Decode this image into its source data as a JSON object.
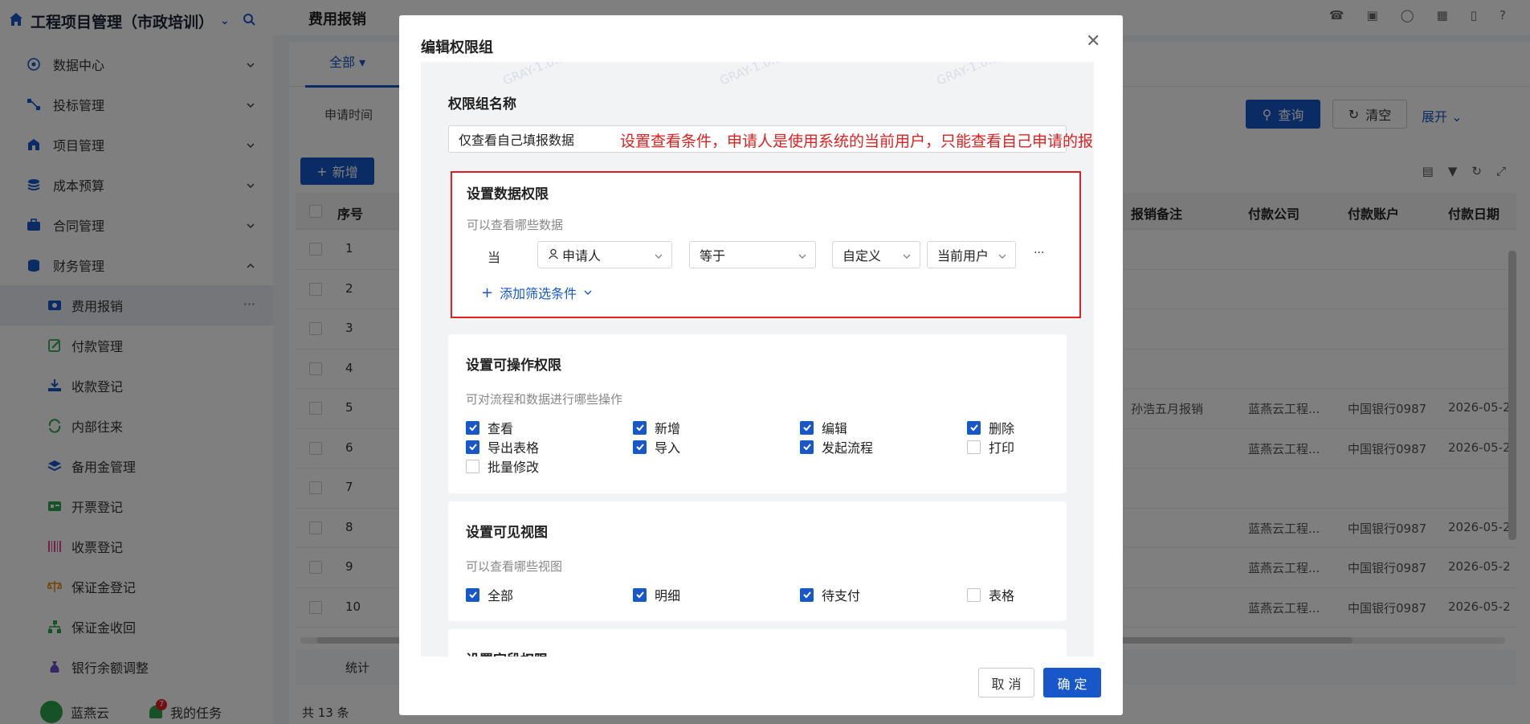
{
  "app": {
    "title": "工程项目管理（市政培训）"
  },
  "sidebar": {
    "items": [
      {
        "label": "数据中心",
        "icon": "dashboard-icon"
      },
      {
        "label": "投标管理",
        "icon": "bidding-icon"
      },
      {
        "label": "项目管理",
        "icon": "project-icon"
      },
      {
        "label": "成本预算",
        "icon": "budget-icon"
      },
      {
        "label": "合同管理",
        "icon": "contract-icon"
      },
      {
        "label": "财务管理",
        "icon": "finance-icon"
      }
    ],
    "sub_items": [
      {
        "label": "费用报销",
        "icon": "reimburse-icon"
      },
      {
        "label": "付款管理",
        "icon": "payment-icon"
      },
      {
        "label": "收款登记",
        "icon": "receipt-icon"
      },
      {
        "label": "内部往来",
        "icon": "transfer-icon"
      },
      {
        "label": "备用金管理",
        "icon": "petty-cash-icon"
      },
      {
        "label": "开票登记",
        "icon": "invoice-icon"
      },
      {
        "label": "收票登记",
        "icon": "barcode-icon"
      },
      {
        "label": "保证金登记",
        "icon": "scale-icon"
      },
      {
        "label": "保证金收回",
        "icon": "org-icon"
      },
      {
        "label": "银行余额调整",
        "icon": "bank-icon"
      }
    ],
    "bottom": {
      "org": "蓝燕云",
      "tasks": "我的任务",
      "task_badge": "7"
    }
  },
  "page": {
    "title": "费用报销",
    "tab_all": "全部",
    "filter_label": "申请时间",
    "search_label": "查询",
    "clear_label": "清空",
    "expand_label": "展开",
    "new_label": "新增",
    "columns": [
      "序号",
      "报销备注",
      "付款公司",
      "付款账户",
      "付款日期"
    ],
    "rows": [
      {
        "no": "1",
        "note": "",
        "company": "",
        "account": "",
        "date": ""
      },
      {
        "no": "2",
        "note": "",
        "company": "",
        "account": "",
        "date": ""
      },
      {
        "no": "3",
        "note": "",
        "company": "",
        "account": "",
        "date": ""
      },
      {
        "no": "4",
        "note": "",
        "company": "",
        "account": "",
        "date": ""
      },
      {
        "no": "5",
        "note": "孙浩五月报销",
        "company": "蓝燕云工程...",
        "account": "中国银行0987",
        "date": "2026-05-2"
      },
      {
        "no": "6",
        "note": "",
        "company": "蓝燕云工程...",
        "account": "中国银行0987",
        "date": "2026-05-2"
      },
      {
        "no": "7",
        "note": "",
        "company": "",
        "account": "",
        "date": ""
      },
      {
        "no": "8",
        "note": "",
        "company": "蓝燕云工程...",
        "account": "中国银行0987",
        "date": "2026-05-2"
      },
      {
        "no": "9",
        "note": "",
        "company": "蓝燕云工程...",
        "account": "中国银行0987",
        "date": "2026-05-2"
      },
      {
        "no": "10",
        "note": "",
        "company": "蓝燕云工程...",
        "account": "中国银行0987",
        "date": "2026-05-2"
      }
    ],
    "summary": "统计",
    "total": "共 13 条"
  },
  "modal": {
    "title": "编辑权限组",
    "group_name_label": "权限组名称",
    "group_name_value": "仅查看自己填报数据",
    "annotation": "设置查看条件，申请人是使用系统的当前用户，只能查看自己申请的报销单据",
    "watermark": "GRAY-1.0.1",
    "data_perm": {
      "title": "设置数据权限",
      "desc": "可以查看哪些数据",
      "when": "当",
      "field": "申请人",
      "operator": "等于",
      "value_type": "自定义",
      "value": "当前用户",
      "more": "···",
      "add": "添加筛选条件"
    },
    "op_perm": {
      "title": "设置可操作权限",
      "desc": "可对流程和数据进行哪些操作",
      "options": [
        {
          "label": "查看",
          "checked": true
        },
        {
          "label": "新增",
          "checked": true
        },
        {
          "label": "编辑",
          "checked": true
        },
        {
          "label": "删除",
          "checked": true
        },
        {
          "label": "导出表格",
          "checked": true
        },
        {
          "label": "导入",
          "checked": true
        },
        {
          "label": "发起流程",
          "checked": true
        },
        {
          "label": "打印",
          "checked": false
        },
        {
          "label": "批量修改",
          "checked": false
        }
      ]
    },
    "view_perm": {
      "title": "设置可见视图",
      "desc": "可以查看哪些视图",
      "options": [
        {
          "label": "全部",
          "checked": true
        },
        {
          "label": "明细",
          "checked": true
        },
        {
          "label": "待支付",
          "checked": true
        },
        {
          "label": "表格",
          "checked": false
        }
      ]
    },
    "field_perm": {
      "title": "设置字段权限"
    },
    "cancel": "取 消",
    "ok": "确 定"
  },
  "colors": {
    "primary": "#1757c9",
    "annotation": "#e02020"
  }
}
